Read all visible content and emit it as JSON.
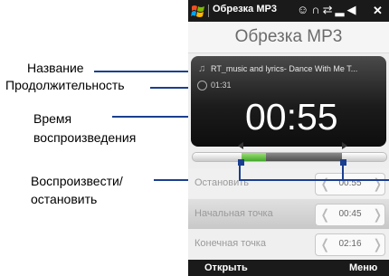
{
  "callouts": {
    "name": "Название",
    "duration": "Продолжительность",
    "play_time_1": "Время",
    "play_time_2": "воспроизведения",
    "play_stop_1": "Воспроизвести/",
    "play_stop_2": "остановить"
  },
  "status_bar": {
    "title": "Обрезка MP3",
    "icons": [
      "chat-icon",
      "headset-icon",
      "sync-icon",
      "signal-icon",
      "volume-icon"
    ],
    "close": "✕"
  },
  "header": {
    "title": "Обрезка MP3"
  },
  "player": {
    "track": "RT_music and lyrics- Dance With Me T...",
    "duration": "01:31",
    "current_time": "00:55"
  },
  "trim": {
    "start_fraction": 0.25,
    "end_fraction": 0.77,
    "played_fraction": 0.38
  },
  "rows": [
    {
      "label": "Остановить",
      "value": "00:55"
    },
    {
      "label": "Начальная точка",
      "value": "00:45"
    },
    {
      "label": "Конечная точка",
      "value": "02:16"
    }
  ],
  "softkeys": {
    "left": "Открыть",
    "right": "Меню"
  },
  "colors": {
    "callout": "#1b3f8f",
    "progress": "#43a82a"
  }
}
